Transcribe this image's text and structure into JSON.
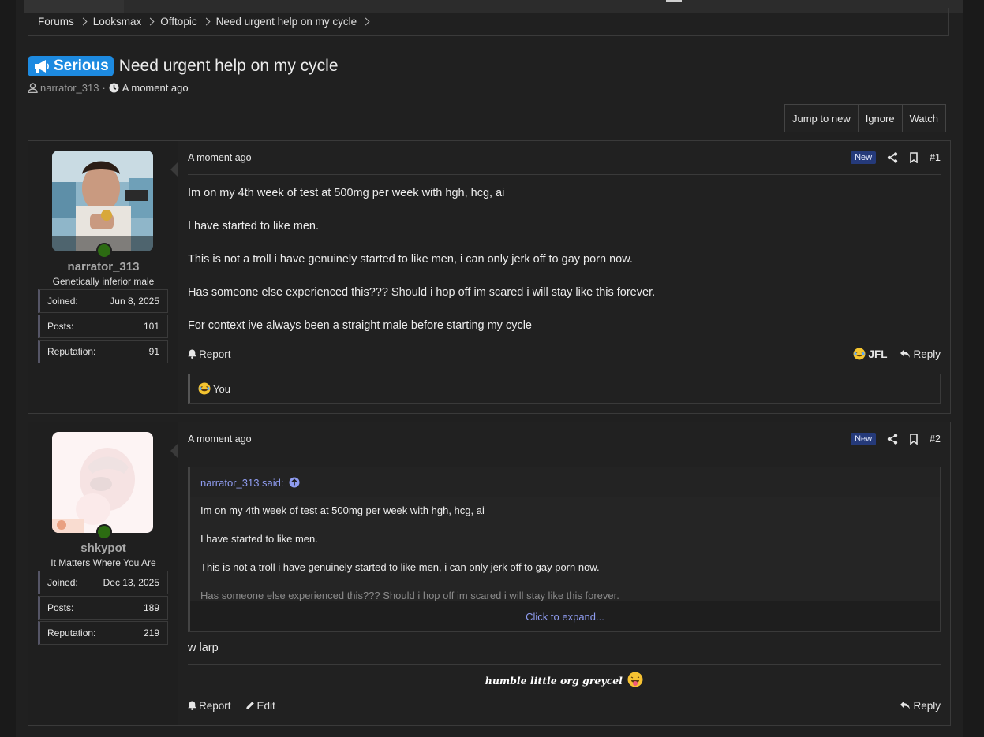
{
  "breadcrumb": [
    "Forums",
    "Looksmax",
    "Offtopic",
    "Need urgent help on my cycle"
  ],
  "thread": {
    "prefix": "Serious",
    "title": "Need urgent help on my cycle",
    "author": "narrator_313",
    "time": "A moment ago"
  },
  "buttons": {
    "jump": "Jump to new",
    "ignore": "Ignore",
    "watch": "Watch"
  },
  "colors": {
    "prefix_bg": "#1d8ae0",
    "online": "#2c6b12",
    "new_badge": "#253a7a",
    "quote_link": "#8f9cf0"
  },
  "posts": [
    {
      "user": {
        "name": "narrator_313",
        "title": "Genetically inferior male",
        "stats": [
          {
            "label": "Joined:",
            "value": "Jun 8, 2025"
          },
          {
            "label": "Posts:",
            "value": "101"
          },
          {
            "label": "Reputation:",
            "value": "91"
          }
        ]
      },
      "time": "A moment ago",
      "badge": "New",
      "number": "#1",
      "body": [
        "Im on my 4th week of test at 500mg per week with hgh, hcg, ai",
        "I have started to like men.",
        "This is not a troll i have genuinely started to like men, i can only jerk off to gay porn now.",
        "Has someone else experienced this??? Should i hop off im scared i will stay like this forever.",
        "For context ive always been a straight male before starting my cycle"
      ],
      "actions": {
        "report": "Report",
        "jfl": "JFL",
        "reply": "Reply"
      },
      "reaction": "You"
    },
    {
      "user": {
        "name": "shkypot",
        "title": "It Matters Where You Are",
        "stats": [
          {
            "label": "Joined:",
            "value": "Dec 13, 2025"
          },
          {
            "label": "Posts:",
            "value": "189"
          },
          {
            "label": "Reputation:",
            "value": "219"
          }
        ]
      },
      "time": "A moment ago",
      "badge": "New",
      "number": "#2",
      "quote": {
        "header": "narrator_313 said:",
        "lines": [
          "Im on my 4th week of test at 500mg per week with hgh, hcg, ai",
          "I have started to like men.",
          "This is not a troll i have genuinely started to like men, i can only jerk off to gay porn now.",
          "Has someone else experienced this??? Should i hop off im scared i will stay like this forever."
        ],
        "expand": "Click to expand..."
      },
      "body": "w larp",
      "signature": "humble little org greycel",
      "actions": {
        "report": "Report",
        "edit": "Edit",
        "reply": "Reply"
      }
    }
  ]
}
